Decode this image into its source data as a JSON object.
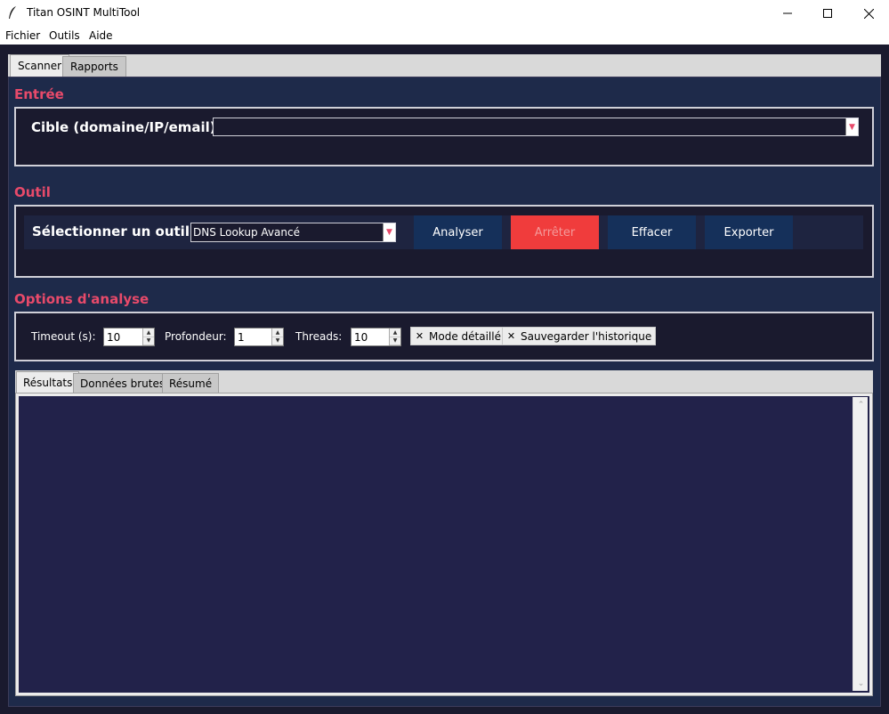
{
  "window": {
    "title": "Titan OSINT MultiTool",
    "icon": "feather-icon",
    "controls": {
      "minimize": "—",
      "maximize": "☐",
      "close": "✕"
    }
  },
  "menubar": {
    "items": [
      "Fichier",
      "Outils",
      "Aide"
    ]
  },
  "main_tabs": [
    {
      "label": "Scanner",
      "active": true
    },
    {
      "label": "Rapports",
      "active": false
    }
  ],
  "entree": {
    "section_title": "Entrée",
    "target_label": "Cible (domaine/IP/email) :",
    "target_value": ""
  },
  "outil": {
    "section_title": "Outil",
    "select_label": "Sélectionner un outil :",
    "selected_tool": "DNS Lookup Avancé",
    "buttons": {
      "analyze": "Analyser",
      "stop": "Arrêter",
      "clear": "Effacer",
      "export": "Exporter"
    }
  },
  "options": {
    "section_title": "Options d'analyse",
    "timeout_label": "Timeout (s):",
    "timeout_value": "10",
    "depth_label": "Profondeur:",
    "depth_value": "1",
    "threads_label": "Threads:",
    "threads_value": "10",
    "detailed_mode": {
      "label": "Mode détaillé",
      "checked": true
    },
    "save_history": {
      "label": "Sauvegarder l'historique",
      "checked": true
    }
  },
  "result_tabs": [
    {
      "label": "Résultats",
      "active": true
    },
    {
      "label": "Données brutes",
      "active": false
    },
    {
      "label": "Résumé",
      "active": false
    }
  ],
  "results_text": "",
  "colors": {
    "background": "#1a1a2e",
    "panel": "#1e2a4a",
    "accent_pink": "#e84a6a",
    "button_blue": "#15305a",
    "button_stop": "#f03c3c",
    "results_bg": "#22224a"
  }
}
